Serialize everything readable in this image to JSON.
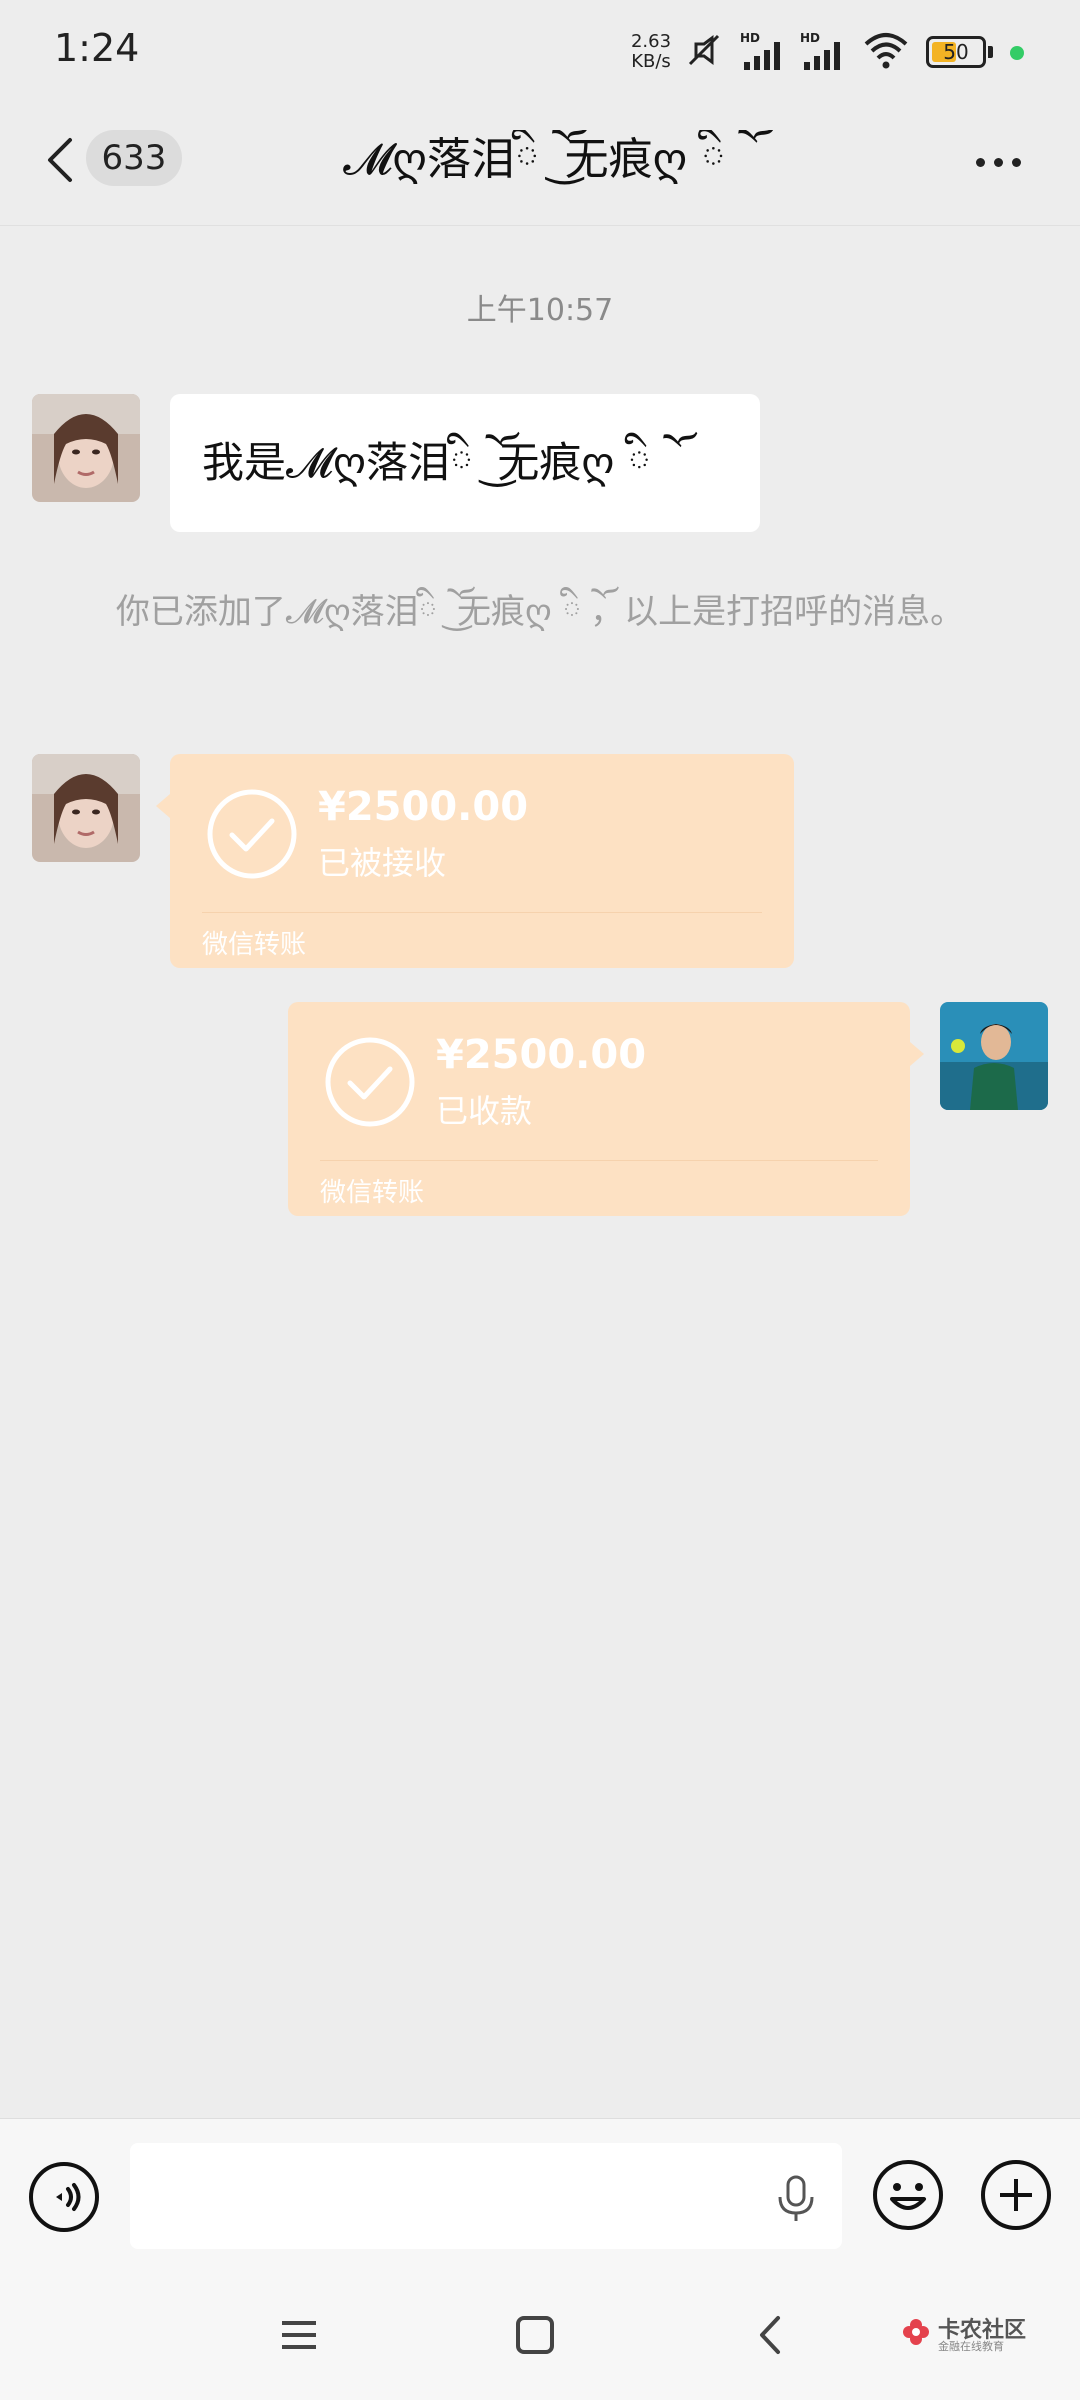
{
  "status_bar": {
    "time": "1:24",
    "net_speed_value": "2.63",
    "net_speed_unit": "KB/s",
    "battery": "50"
  },
  "header": {
    "unread_count": "633",
    "title": "𝓜ღ落泪ི ོ ͜无痕ღ ི ོ"
  },
  "chat": {
    "timestamp": "上午10:57",
    "greeting_message": "我是𝓜ღ落泪ི ོ ͜无痕ღ ི ོ",
    "system_message": "你已添加了𝓜ღ落泪ི ོ ͜无痕ღ ི ོ，以上是打招呼的消息。",
    "transfers": [
      {
        "side": "left",
        "amount": "¥2500.00",
        "status": "已被接收",
        "footer": "微信转账"
      },
      {
        "side": "right",
        "amount": "¥2500.00",
        "status": "已收款",
        "footer": "微信转账"
      }
    ]
  },
  "input": {
    "placeholder": ""
  },
  "watermark": {
    "main": "卡农社区",
    "sub": "金融在线教育"
  },
  "colors": {
    "background": "#ededed",
    "transfer_bubble": "#fde1c3",
    "battery": "#f3b324"
  }
}
